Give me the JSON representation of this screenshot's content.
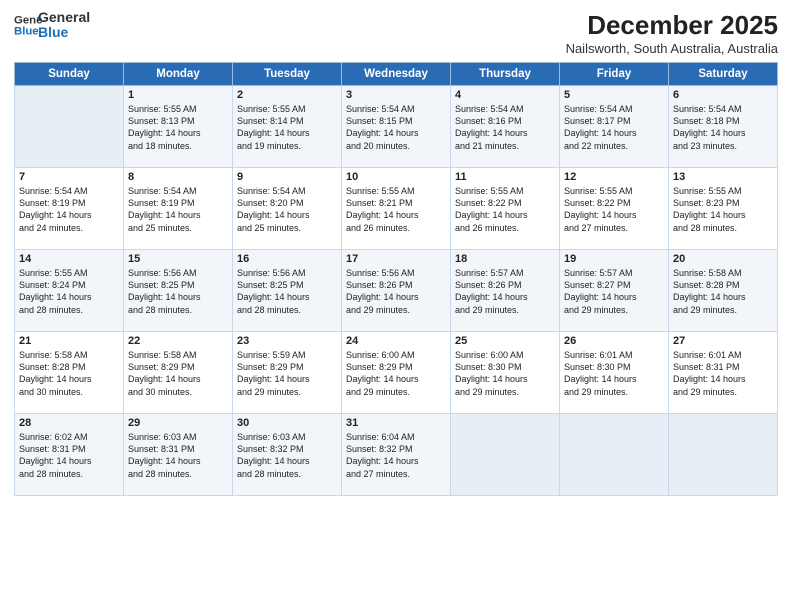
{
  "logo": {
    "line1": "General",
    "line2": "Blue"
  },
  "title": "December 2025",
  "subtitle": "Nailsworth, South Australia, Australia",
  "days_of_week": [
    "Sunday",
    "Monday",
    "Tuesday",
    "Wednesday",
    "Thursday",
    "Friday",
    "Saturday"
  ],
  "weeks": [
    [
      {
        "day": "",
        "content": ""
      },
      {
        "day": "1",
        "content": "Sunrise: 5:55 AM\nSunset: 8:13 PM\nDaylight: 14 hours\nand 18 minutes."
      },
      {
        "day": "2",
        "content": "Sunrise: 5:55 AM\nSunset: 8:14 PM\nDaylight: 14 hours\nand 19 minutes."
      },
      {
        "day": "3",
        "content": "Sunrise: 5:54 AM\nSunset: 8:15 PM\nDaylight: 14 hours\nand 20 minutes."
      },
      {
        "day": "4",
        "content": "Sunrise: 5:54 AM\nSunset: 8:16 PM\nDaylight: 14 hours\nand 21 minutes."
      },
      {
        "day": "5",
        "content": "Sunrise: 5:54 AM\nSunset: 8:17 PM\nDaylight: 14 hours\nand 22 minutes."
      },
      {
        "day": "6",
        "content": "Sunrise: 5:54 AM\nSunset: 8:18 PM\nDaylight: 14 hours\nand 23 minutes."
      }
    ],
    [
      {
        "day": "7",
        "content": "Sunrise: 5:54 AM\nSunset: 8:19 PM\nDaylight: 14 hours\nand 24 minutes."
      },
      {
        "day": "8",
        "content": "Sunrise: 5:54 AM\nSunset: 8:19 PM\nDaylight: 14 hours\nand 25 minutes."
      },
      {
        "day": "9",
        "content": "Sunrise: 5:54 AM\nSunset: 8:20 PM\nDaylight: 14 hours\nand 25 minutes."
      },
      {
        "day": "10",
        "content": "Sunrise: 5:55 AM\nSunset: 8:21 PM\nDaylight: 14 hours\nand 26 minutes."
      },
      {
        "day": "11",
        "content": "Sunrise: 5:55 AM\nSunset: 8:22 PM\nDaylight: 14 hours\nand 26 minutes."
      },
      {
        "day": "12",
        "content": "Sunrise: 5:55 AM\nSunset: 8:22 PM\nDaylight: 14 hours\nand 27 minutes."
      },
      {
        "day": "13",
        "content": "Sunrise: 5:55 AM\nSunset: 8:23 PM\nDaylight: 14 hours\nand 28 minutes."
      }
    ],
    [
      {
        "day": "14",
        "content": "Sunrise: 5:55 AM\nSunset: 8:24 PM\nDaylight: 14 hours\nand 28 minutes."
      },
      {
        "day": "15",
        "content": "Sunrise: 5:56 AM\nSunset: 8:25 PM\nDaylight: 14 hours\nand 28 minutes."
      },
      {
        "day": "16",
        "content": "Sunrise: 5:56 AM\nSunset: 8:25 PM\nDaylight: 14 hours\nand 28 minutes."
      },
      {
        "day": "17",
        "content": "Sunrise: 5:56 AM\nSunset: 8:26 PM\nDaylight: 14 hours\nand 29 minutes."
      },
      {
        "day": "18",
        "content": "Sunrise: 5:57 AM\nSunset: 8:26 PM\nDaylight: 14 hours\nand 29 minutes."
      },
      {
        "day": "19",
        "content": "Sunrise: 5:57 AM\nSunset: 8:27 PM\nDaylight: 14 hours\nand 29 minutes."
      },
      {
        "day": "20",
        "content": "Sunrise: 5:58 AM\nSunset: 8:28 PM\nDaylight: 14 hours\nand 29 minutes."
      }
    ],
    [
      {
        "day": "21",
        "content": "Sunrise: 5:58 AM\nSunset: 8:28 PM\nDaylight: 14 hours\nand 30 minutes."
      },
      {
        "day": "22",
        "content": "Sunrise: 5:58 AM\nSunset: 8:29 PM\nDaylight: 14 hours\nand 30 minutes."
      },
      {
        "day": "23",
        "content": "Sunrise: 5:59 AM\nSunset: 8:29 PM\nDaylight: 14 hours\nand 29 minutes."
      },
      {
        "day": "24",
        "content": "Sunrise: 6:00 AM\nSunset: 8:29 PM\nDaylight: 14 hours\nand 29 minutes."
      },
      {
        "day": "25",
        "content": "Sunrise: 6:00 AM\nSunset: 8:30 PM\nDaylight: 14 hours\nand 29 minutes."
      },
      {
        "day": "26",
        "content": "Sunrise: 6:01 AM\nSunset: 8:30 PM\nDaylight: 14 hours\nand 29 minutes."
      },
      {
        "day": "27",
        "content": "Sunrise: 6:01 AM\nSunset: 8:31 PM\nDaylight: 14 hours\nand 29 minutes."
      }
    ],
    [
      {
        "day": "28",
        "content": "Sunrise: 6:02 AM\nSunset: 8:31 PM\nDaylight: 14 hours\nand 28 minutes."
      },
      {
        "day": "29",
        "content": "Sunrise: 6:03 AM\nSunset: 8:31 PM\nDaylight: 14 hours\nand 28 minutes."
      },
      {
        "day": "30",
        "content": "Sunrise: 6:03 AM\nSunset: 8:32 PM\nDaylight: 14 hours\nand 28 minutes."
      },
      {
        "day": "31",
        "content": "Sunrise: 6:04 AM\nSunset: 8:32 PM\nDaylight: 14 hours\nand 27 minutes."
      },
      {
        "day": "",
        "content": ""
      },
      {
        "day": "",
        "content": ""
      },
      {
        "day": "",
        "content": ""
      }
    ]
  ]
}
